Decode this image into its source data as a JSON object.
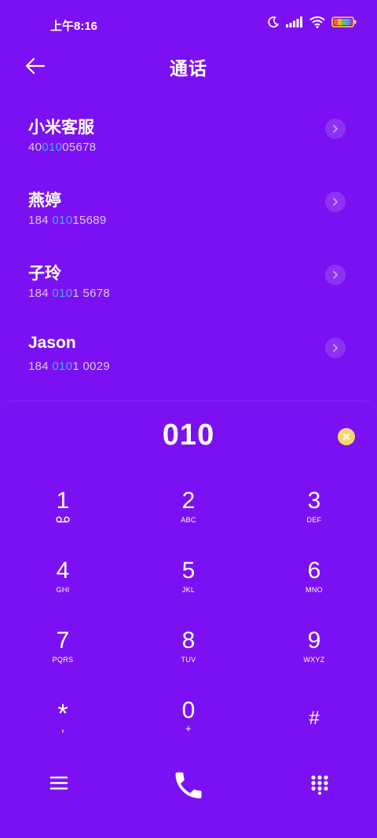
{
  "status": {
    "time": "上午8:16",
    "icons": [
      "moon-icon",
      "signal-icon",
      "wifi-icon",
      "battery-icon"
    ]
  },
  "header": {
    "title": "通话",
    "back_icon": "arrow-left-icon"
  },
  "contacts": [
    {
      "name": "小米客服",
      "number_pre": "40",
      "number_match": "010",
      "number_post": "05678"
    },
    {
      "name": "燕婷",
      "number_pre": "184 ",
      "number_match": "010",
      "number_post": "15689"
    },
    {
      "name": "子玲",
      "number_pre": "184 ",
      "number_match": "010",
      "number_post": "1 5678"
    },
    {
      "name": "Jason",
      "number_pre": "184 ",
      "number_match": "010",
      "number_post": "1 0029"
    }
  ],
  "dialer": {
    "input": "010",
    "keys": [
      {
        "digit": "1",
        "letters": ""
      },
      {
        "digit": "2",
        "letters": "ABC"
      },
      {
        "digit": "3",
        "letters": "DEF"
      },
      {
        "digit": "4",
        "letters": "GHI"
      },
      {
        "digit": "5",
        "letters": "JKL"
      },
      {
        "digit": "6",
        "letters": "MNO"
      },
      {
        "digit": "7",
        "letters": "PQRS"
      },
      {
        "digit": "8",
        "letters": "TUV"
      },
      {
        "digit": "9",
        "letters": "WXYZ"
      },
      {
        "digit": "*",
        "letters": ","
      },
      {
        "digit": "0",
        "letters": "+"
      },
      {
        "digit": "#",
        "letters": ""
      }
    ]
  },
  "colors": {
    "background": "#7b11f2",
    "match_highlight": "#4aa8ff",
    "clear_button": "#f6d76f"
  }
}
